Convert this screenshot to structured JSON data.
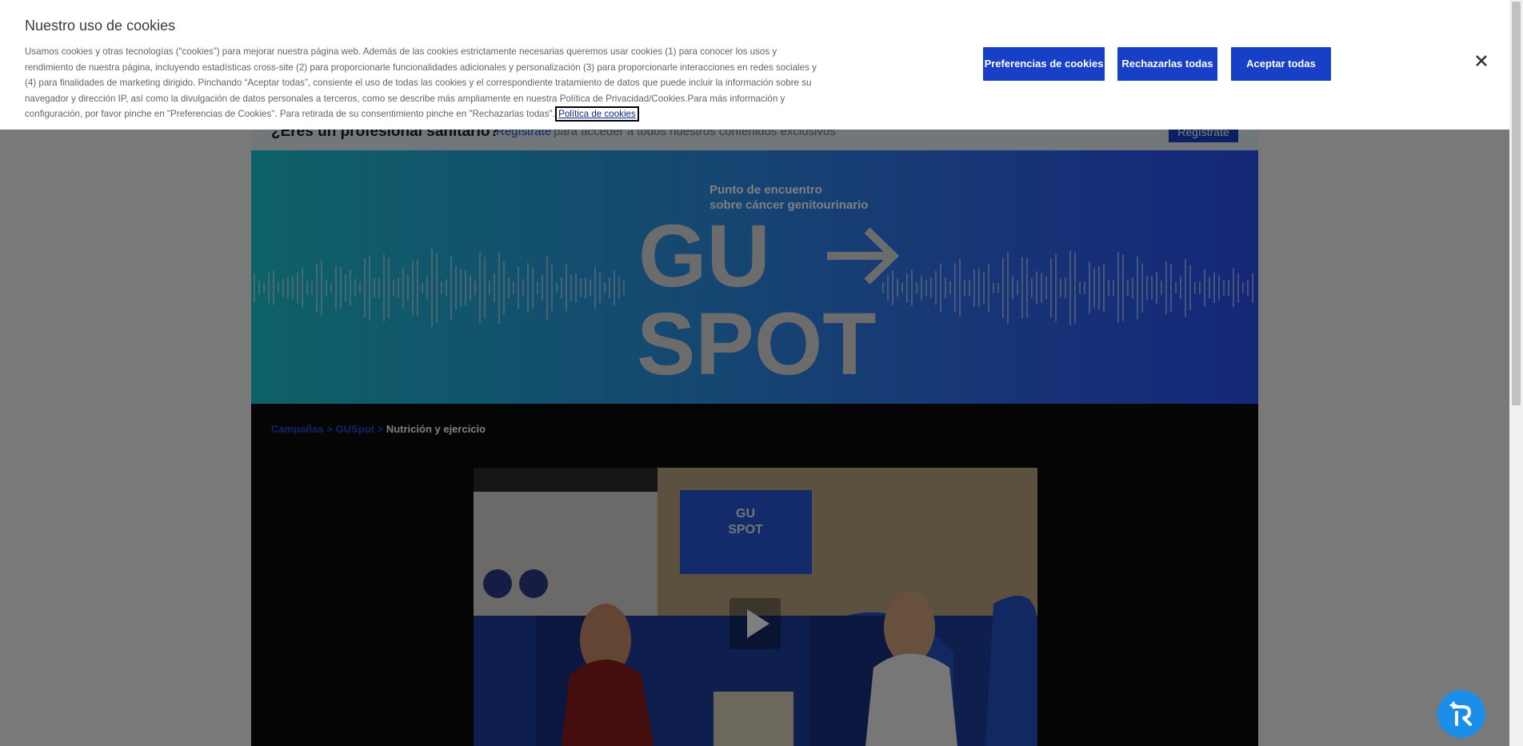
{
  "cookie_banner": {
    "title": "Nuestro uso de cookies",
    "description": "Usamos cookies y otras tecnologías (“cookies”) para mejorar nuestra página web. Además de las cookies estrictamente necesarias queremos usar cookies (1) para conocer los usos y rendimiento de nuestra página, incluyendo estadísticas cross-site (2) para proporcionarle funcionalidades adicionales y personalización (3) para proporcionarle interacciones en redes sociales y (4) para finalidades de marketing dirigido. Pinchando “Aceptar todas”, consiente el uso de todas las cookies y el correspondiente tratamiento de datos que puede incluir la información sobre su navegador y dirección IP, así como la divulgación de datos personales a terceros, como se describe más ampliamente en nuestra Política de Privacidad/Cookies.Para más información y configuración, por favor pinche en \"Preferencias de Cookies\". Para retirada de su consentimiento pinche en \"Rechazarlas todas\".",
    "policy_link": "Política de cookies",
    "preferences_button": "Preferencias de cookies",
    "reject_button": "Rechazarlas todas",
    "accept_button": "Aceptar todas",
    "close_icon": "close-icon"
  },
  "hcp_bar": {
    "question": "¿Eres un profesional sanitario?",
    "register_link": "Regístrate",
    "rest_text": "para acceder a todos nuestros contenidos exclusivos",
    "register_button": "Regístrate"
  },
  "hero": {
    "tagline_line1": "Punto de encuentro",
    "tagline_line2": "sobre cáncer genitourinario",
    "logo_top": "GU",
    "logo_bottom": "SPOT"
  },
  "breadcrumb": {
    "items": [
      "Campañas",
      "GUSpot"
    ],
    "separator": ">",
    "current": "Nutrición y ejercicio"
  },
  "video": {
    "play_icon": "play-icon",
    "screen_logo_top": "GU",
    "screen_logo_bottom": "SPOT"
  },
  "fab": {
    "icon": "assistant-r-icon"
  },
  "colors": {
    "button_blue": "#1740c7",
    "overlay": "rgba(0,0,0,0.5)",
    "fab": "#1a8ee8"
  }
}
